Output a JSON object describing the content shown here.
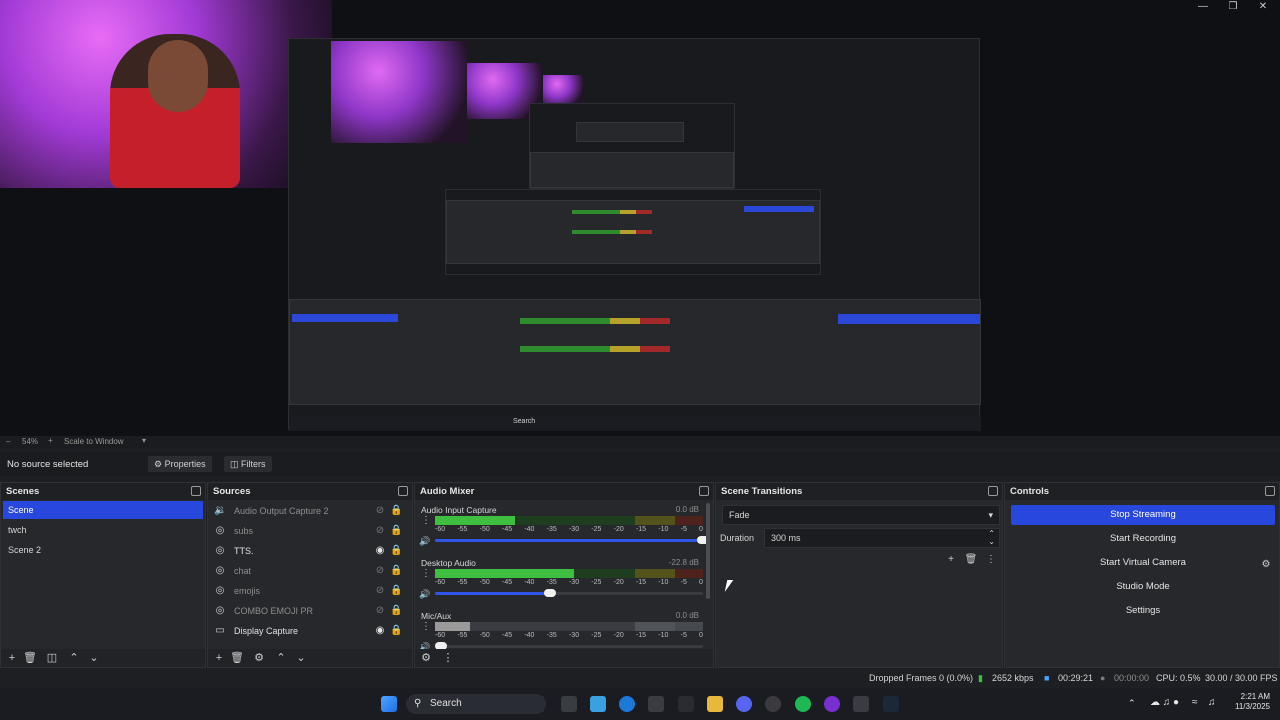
{
  "window": {
    "controls": [
      "—",
      "❒",
      "✕"
    ]
  },
  "preview": {
    "scale_percent": "54%",
    "scale_mode": "Scale to Window",
    "nested_taskbar_search": "Search"
  },
  "context_bar": {
    "status": "No source selected",
    "properties_label": "Properties",
    "filters_label": "Filters"
  },
  "scenes": {
    "title": "Scenes",
    "items": [
      {
        "label": "Scene",
        "selected": true
      },
      {
        "label": "twch",
        "selected": false
      },
      {
        "label": "Scene 2",
        "selected": false
      }
    ]
  },
  "sources": {
    "title": "Sources",
    "items": [
      {
        "label": "Audio Output Capture 2",
        "icon": "speaker-icon",
        "visible": false
      },
      {
        "label": "subs",
        "icon": "globe-icon",
        "visible": false
      },
      {
        "label": "TTS.",
        "icon": "globe-icon",
        "visible": true
      },
      {
        "label": "chat",
        "icon": "globe-icon",
        "visible": false
      },
      {
        "label": "emojis",
        "icon": "globe-icon",
        "visible": false
      },
      {
        "label": "COMBO EMOJI PR",
        "icon": "globe-icon",
        "visible": false
      },
      {
        "label": "Display Capture",
        "icon": "monitor-icon",
        "visible": true
      }
    ]
  },
  "audio_mixer": {
    "title": "Audio Mixer",
    "ticks": [
      "-60",
      "-55",
      "-50",
      "-45",
      "-40",
      "-35",
      "-30",
      "-25",
      "-20",
      "-15",
      "-10",
      "-5",
      "0"
    ],
    "channels": [
      {
        "name": "Audio Input Capture",
        "db": "0.0 dB",
        "level": 0.3,
        "volume": 1.0
      },
      {
        "name": "Desktop Audio",
        "db": "-22.8 dB",
        "level": 0.52,
        "volume": 0.43
      },
      {
        "name": "Mic/Aux",
        "db": "0.0 dB",
        "level": 0.13,
        "volume": 0.0
      }
    ]
  },
  "scene_transitions": {
    "title": "Scene Transitions",
    "transition": "Fade",
    "duration_label": "Duration",
    "duration_value": "300 ms"
  },
  "controls": {
    "title": "Controls",
    "buttons": [
      {
        "label": "Stop Streaming",
        "active": true
      },
      {
        "label": "Start Recording",
        "active": false
      },
      {
        "label": "Start Virtual Camera",
        "active": false
      },
      {
        "label": "Studio Mode",
        "active": false
      },
      {
        "label": "Settings",
        "active": false
      }
    ]
  },
  "status_bar": {
    "dropped_frames": "Dropped Frames 0 (0.0%)",
    "bitrate": "2652 kbps",
    "stream_time": "00:29:21",
    "record_time": "00:00:00",
    "cpu": "CPU: 0.5%",
    "fps": "30.00 / 30.00 FPS"
  },
  "taskbar": {
    "search_label": "Search",
    "time": "2:21 AM",
    "date": "11/3/2025"
  },
  "colors": {
    "accent": "#2847dc",
    "meter_green": "#3fbf3f",
    "meter_yellow": "#b6a12a",
    "meter_red": "#a32a2a"
  }
}
